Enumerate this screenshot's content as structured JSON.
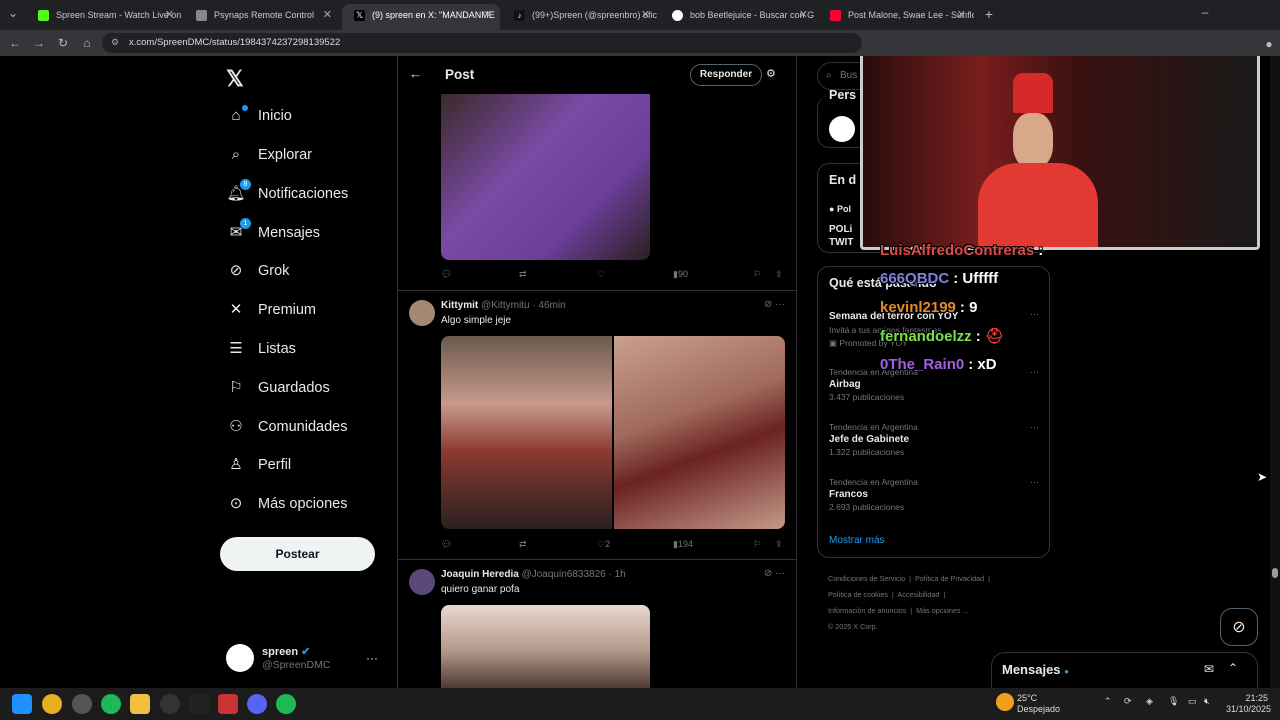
{
  "browser": {
    "tabs": [
      {
        "title": "Spreen Stream - Watch Live on",
        "color": "#53fc18"
      },
      {
        "title": "Psynaps Remote Control",
        "color": "#888888"
      },
      {
        "title": "(9) spreen en X: \"MANDANME",
        "color": "#ffffff"
      },
      {
        "title": "(99+)Spreen (@spreenbro) ofic",
        "color": "#ffffff"
      },
      {
        "title": "bob Beetlejuice - Buscar con G",
        "color": "#ffffff"
      },
      {
        "title": "Post Malone, Swae Lee - Sunflo",
        "color": "#ff0033"
      }
    ],
    "url": "x.com/SpreenDMC/status/1984374237298139522"
  },
  "sidebar": {
    "items": [
      {
        "label": "Inicio",
        "icon": "home-icon"
      },
      {
        "label": "Explorar",
        "icon": "search-icon"
      },
      {
        "label": "Notificaciones",
        "icon": "bell-icon",
        "badge": "8"
      },
      {
        "label": "Mensajes",
        "icon": "mail-icon",
        "badge": "1"
      },
      {
        "label": "Grok",
        "icon": "grok-icon"
      },
      {
        "label": "Premium",
        "icon": "x-icon"
      },
      {
        "label": "Listas",
        "icon": "list-icon"
      },
      {
        "label": "Guardados",
        "icon": "bookmark-icon"
      },
      {
        "label": "Comunidades",
        "icon": "people-icon"
      },
      {
        "label": "Perfil",
        "icon": "user-icon"
      },
      {
        "label": "Más opciones",
        "icon": "more-icon"
      }
    ],
    "post_button": "Postear",
    "account": {
      "name": "spreen",
      "handle": "@SpreenDMC"
    }
  },
  "header": {
    "title": "Post",
    "reply_button": "Responder"
  },
  "tweets": [
    {
      "views": "90"
    },
    {
      "name": "Kittymit",
      "handle": "@Kittymitu",
      "time": "· 46min",
      "text": "Algo simple jeje",
      "likes": "2",
      "views": "194"
    },
    {
      "name": "Joaquin Heredia",
      "handle": "@Joaquin6833826",
      "time": "· 1h",
      "text": "quiero ganar pofa"
    }
  ],
  "right": {
    "search_placeholder": "Bus",
    "who_title": "Pers",
    "news_title": "En d",
    "news_source": "Pol",
    "news_line1": "POLi",
    "news_line2": "TWIT",
    "happening_title": "Qué está pasando",
    "promo": {
      "title": "Semana del terror con YOY",
      "desc": "Invitá a tus amigos fantasmas",
      "tag": "Promoted by YOY"
    },
    "trends": [
      {
        "context": "Tendencia en Argentina",
        "name": "Airbag",
        "posts": "3.437 publicaciones"
      },
      {
        "context": "Tendencia en Argentina",
        "name": "Jefe de Gabinete",
        "posts": "1.322 publicaciones"
      },
      {
        "context": "Tendencia en Argentina",
        "name": "Francos",
        "posts": "2.693 publicaciones"
      }
    ],
    "show_more": "Mostrar más",
    "footer": [
      "Condiciones de Servicio",
      "Política de Privacidad",
      "Política de cookies",
      "Accesibilidad",
      "Información de anuncios",
      "Más opciones ...",
      "© 2025 X Corp."
    ]
  },
  "messages_bar": {
    "title": "Mensajes"
  },
  "chat_overlay": [
    {
      "user": "LuisAlfredoContreras",
      "msg": ":",
      "color": "#d94c4c"
    },
    {
      "user": "666QBDC",
      "msg": ": Ufffff",
      "color": "#6a6ad9"
    },
    {
      "user": "kevinl2199",
      "msg": ": 9",
      "color": "#e08a2a"
    },
    {
      "user": "fernandoelzz",
      "msg": ":",
      "color": "#7de04a"
    },
    {
      "user": "0The_Rain0",
      "msg": ": xD",
      "color": "#a060e0"
    }
  ],
  "taskbar": {
    "weather_temp": "25°C",
    "weather_desc": "Despejado",
    "time": "21:25",
    "date": "31/10/2025"
  }
}
